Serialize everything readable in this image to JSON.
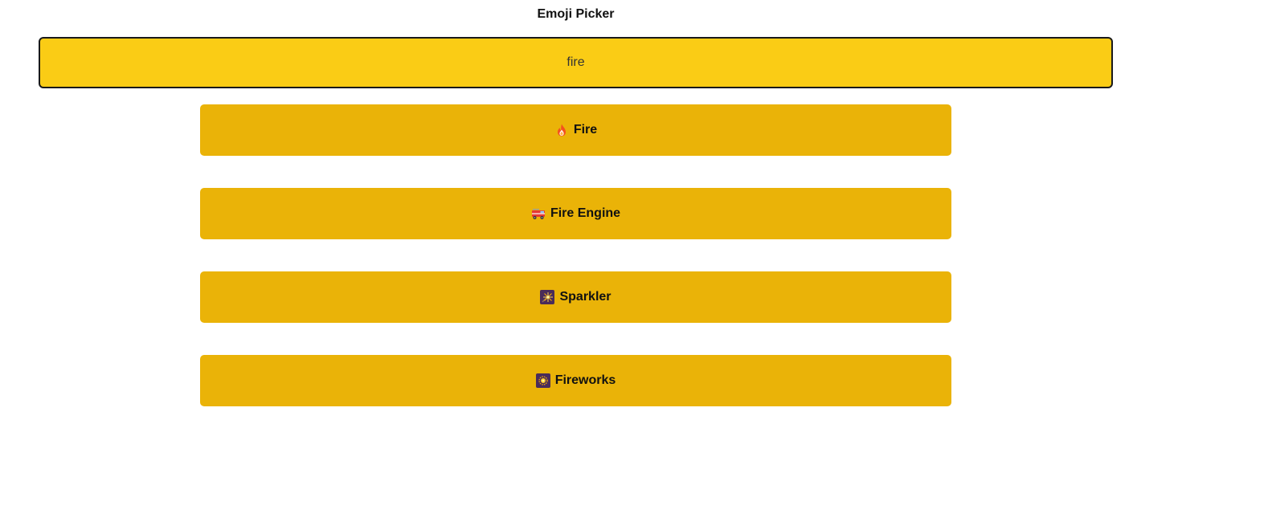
{
  "header": {
    "title": "Emoji Picker"
  },
  "search": {
    "value": "fire"
  },
  "results": [
    {
      "label": "Fire",
      "icon": "fire-icon"
    },
    {
      "label": "Fire Engine",
      "icon": "fire-engine-icon"
    },
    {
      "label": "Sparkler",
      "icon": "sparkler-icon"
    },
    {
      "label": "Fireworks",
      "icon": "fireworks-icon"
    }
  ],
  "colors": {
    "search_background": "#facc15",
    "search_border": "#1a1a1a",
    "result_background": "#eab308",
    "text": "#111111"
  }
}
